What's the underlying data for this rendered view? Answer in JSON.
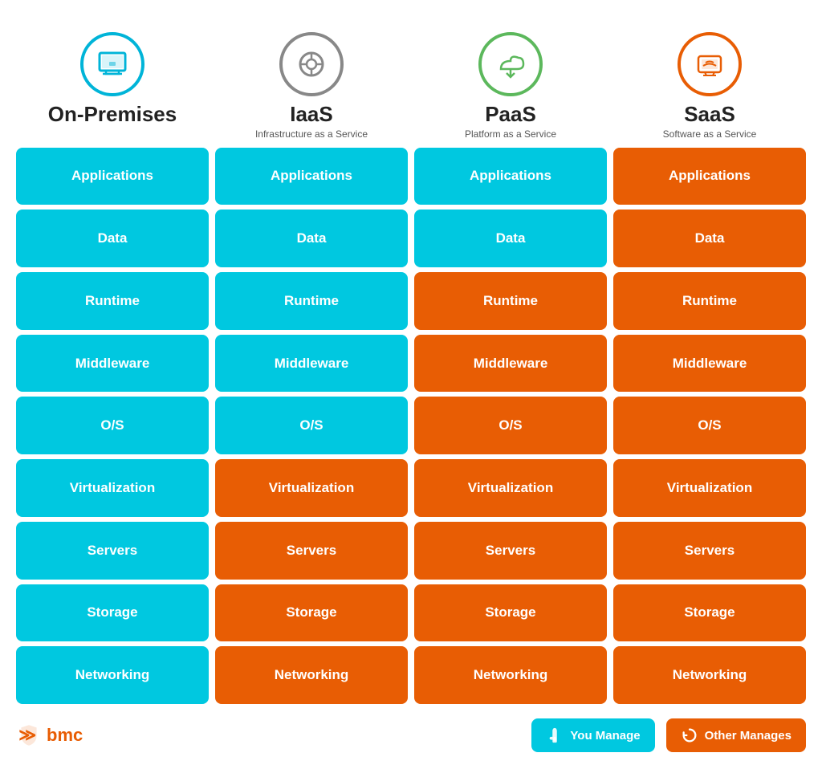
{
  "columns": [
    {
      "id": "on-premises",
      "icon": "💻",
      "icon_style": "blue",
      "title": "On-Premises",
      "subtitle": "",
      "rows": [
        {
          "label": "Applications",
          "style": "blue"
        },
        {
          "label": "Data",
          "style": "blue"
        },
        {
          "label": "Runtime",
          "style": "blue"
        },
        {
          "label": "Middleware",
          "style": "blue"
        },
        {
          "label": "O/S",
          "style": "blue"
        },
        {
          "label": "Virtualization",
          "style": "blue"
        },
        {
          "label": "Servers",
          "style": "blue"
        },
        {
          "label": "Storage",
          "style": "blue"
        },
        {
          "label": "Networking",
          "style": "blue"
        }
      ]
    },
    {
      "id": "iaas",
      "icon": "⚙️",
      "icon_style": "grey",
      "title": "IaaS",
      "subtitle": "Infrastructure as a Service",
      "rows": [
        {
          "label": "Applications",
          "style": "blue"
        },
        {
          "label": "Data",
          "style": "blue"
        },
        {
          "label": "Runtime",
          "style": "blue"
        },
        {
          "label": "Middleware",
          "style": "blue"
        },
        {
          "label": "O/S",
          "style": "blue"
        },
        {
          "label": "Virtualization",
          "style": "orange"
        },
        {
          "label": "Servers",
          "style": "orange"
        },
        {
          "label": "Storage",
          "style": "orange"
        },
        {
          "label": "Networking",
          "style": "orange"
        }
      ]
    },
    {
      "id": "paas",
      "icon": "☁️",
      "icon_style": "green",
      "title": "PaaS",
      "subtitle": "Platform as a Service",
      "rows": [
        {
          "label": "Applications",
          "style": "blue"
        },
        {
          "label": "Data",
          "style": "blue"
        },
        {
          "label": "Runtime",
          "style": "orange"
        },
        {
          "label": "Middleware",
          "style": "orange"
        },
        {
          "label": "O/S",
          "style": "orange"
        },
        {
          "label": "Virtualization",
          "style": "orange"
        },
        {
          "label": "Servers",
          "style": "orange"
        },
        {
          "label": "Storage",
          "style": "orange"
        },
        {
          "label": "Networking",
          "style": "orange"
        }
      ]
    },
    {
      "id": "saas",
      "icon": "🖥️",
      "icon_style": "orange",
      "title": "SaaS",
      "subtitle": "Software as a Service",
      "rows": [
        {
          "label": "Applications",
          "style": "orange"
        },
        {
          "label": "Data",
          "style": "orange"
        },
        {
          "label": "Runtime",
          "style": "orange"
        },
        {
          "label": "Middleware",
          "style": "orange"
        },
        {
          "label": "O/S",
          "style": "orange"
        },
        {
          "label": "Virtualization",
          "style": "orange"
        },
        {
          "label": "Servers",
          "style": "orange"
        },
        {
          "label": "Storage",
          "style": "orange"
        },
        {
          "label": "Networking",
          "style": "orange"
        }
      ]
    }
  ],
  "footer": {
    "logo_text": "bmc",
    "legend": [
      {
        "label": "You Manage",
        "style": "blue",
        "icon": "👆"
      },
      {
        "label": "Other Manages",
        "style": "orange",
        "icon": "🔄"
      }
    ]
  },
  "row_count": 9
}
